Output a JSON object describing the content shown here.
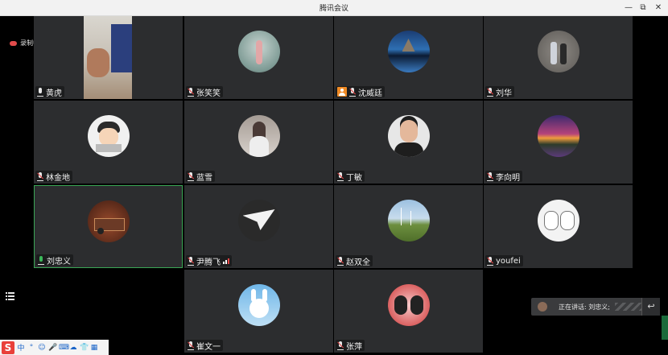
{
  "window": {
    "title": "腾讯会议",
    "minimize": "—",
    "maximize": "⧉",
    "close": "✕"
  },
  "recording": {
    "label": "录制中"
  },
  "participants": [
    {
      "name": "黄虎",
      "mic": "on-white"
    },
    {
      "name": "张笑笑",
      "mic": "off"
    },
    {
      "name": "沈威廷",
      "mic": "off",
      "badge": "host"
    },
    {
      "name": "刘华",
      "mic": "off"
    },
    {
      "name": "林金地",
      "mic": "off"
    },
    {
      "name": "蓝雪",
      "mic": "off"
    },
    {
      "name": "丁敏",
      "mic": "off"
    },
    {
      "name": "李向明",
      "mic": "off"
    },
    {
      "name": "刘忠义",
      "mic": "speaking"
    },
    {
      "name": "尹腾飞",
      "mic": "off",
      "signal": "weak"
    },
    {
      "name": "赵双全",
      "mic": "off"
    },
    {
      "name": "youfei",
      "mic": "off"
    },
    {
      "name": "崔文一",
      "mic": "off"
    },
    {
      "name": "张萍",
      "mic": "off"
    }
  ],
  "speaking": {
    "label": "正在讲话: 刘忠义;"
  },
  "taskbar": {
    "app": "S",
    "items": [
      "中",
      "°",
      "☺",
      "🎤",
      "⌨",
      "☁",
      "👕",
      "▦"
    ]
  },
  "colors": {
    "active_border": "#3aa655",
    "tile_bg": "#2c2d2f",
    "stage_bg": "#000000",
    "mic_off": "#e34444",
    "speaking_mic": "#3bb85a"
  }
}
